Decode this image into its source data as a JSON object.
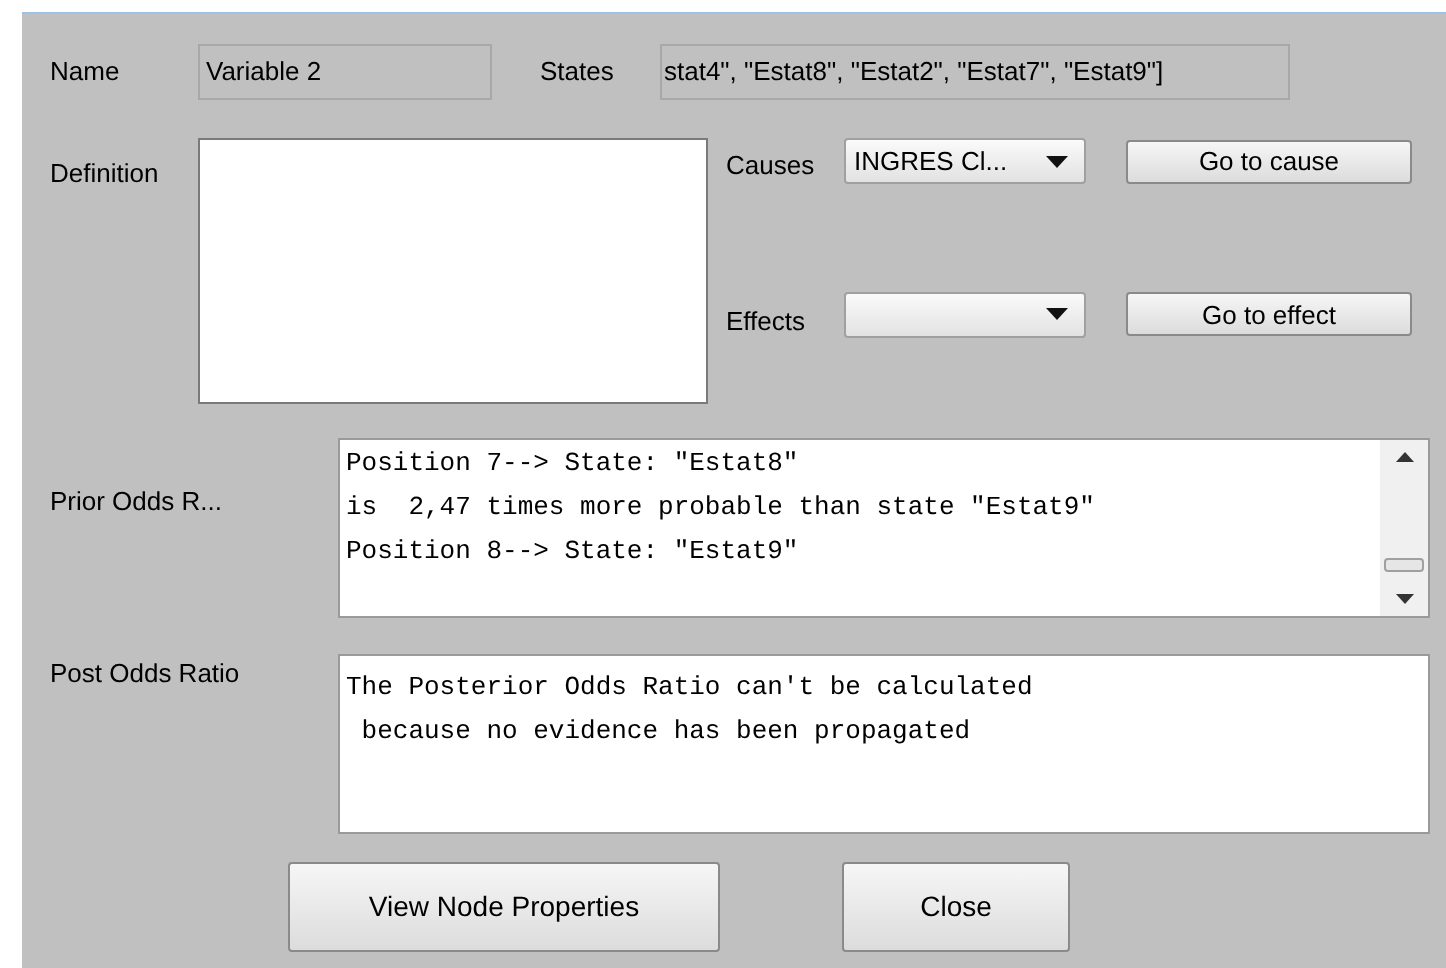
{
  "name": {
    "label": "Name",
    "value": "Variable 2"
  },
  "states": {
    "label": "States",
    "value": "stat4\", \"Estat8\", \"Estat2\", \"Estat7\", \"Estat9\"]"
  },
  "definition": {
    "label": "Definition"
  },
  "causes": {
    "label": "Causes",
    "value": "INGRES Cl...",
    "button": "Go to cause"
  },
  "effects": {
    "label": "Effects",
    "button": "Go to effect"
  },
  "prior_odds": {
    "label": "Prior Odds R...",
    "lines": [
      "Position 7--> State: \"Estat8\"",
      "is  2,47 times more probable than state \"Estat9\"",
      "Position 8--> State: \"Estat9\""
    ]
  },
  "post_odds": {
    "label": "Post Odds Ratio",
    "lines": [
      "The Posterior Odds Ratio can't be calculated",
      " because no evidence has been propagated"
    ]
  },
  "buttons": [
    "View Node Properties",
    "Close"
  ]
}
